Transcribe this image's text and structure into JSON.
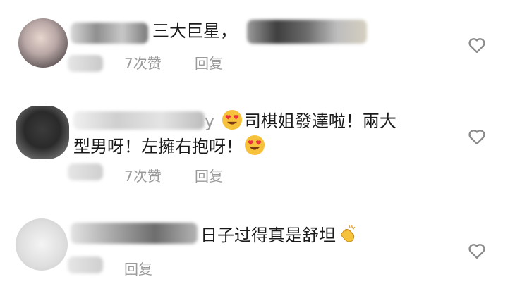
{
  "comments": [
    {
      "text_fragment": "三大巨星，",
      "likes": "7次赞",
      "reply_label": "回复",
      "like_icon": "heart-outline-icon"
    },
    {
      "username_tail": "y",
      "line1": "司棋姐發達啦！兩大",
      "line2": "型男呀！左擁右抱呀！",
      "likes": "7次赞",
      "reply_label": "回复",
      "emoji": "heart-eyes-emoji-icon",
      "like_icon": "heart-outline-icon"
    },
    {
      "text": "日子过得真是舒坦",
      "reply_label": "回复",
      "emoji": "clapping-hands-emoji-icon",
      "like_icon": "heart-outline-icon"
    }
  ],
  "colors": {
    "text": "#1a1a1a",
    "meta": "#9a9a9a",
    "heart_outline": "#8a8a8a",
    "emoji_face": "#f7c23b",
    "emoji_heart": "#e8323c"
  }
}
